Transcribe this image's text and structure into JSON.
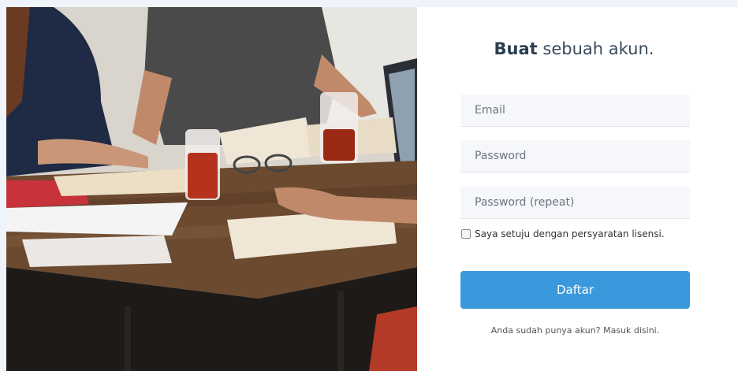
{
  "form": {
    "title_bold": "Buat",
    "title_rest": " sebuah akun.",
    "email_placeholder": "Email",
    "password_placeholder": "Password",
    "password_repeat_placeholder": "Password (repeat)",
    "terms_label": "Saya setuju dengan persyaratan lisensi.",
    "submit_label": "Daftar",
    "login_link": "Anda sudah punya akun? Masuk disini."
  },
  "colors": {
    "page_background": "#eef4fa",
    "button": "#3a99dc",
    "field_background": "#f5f7fa"
  }
}
